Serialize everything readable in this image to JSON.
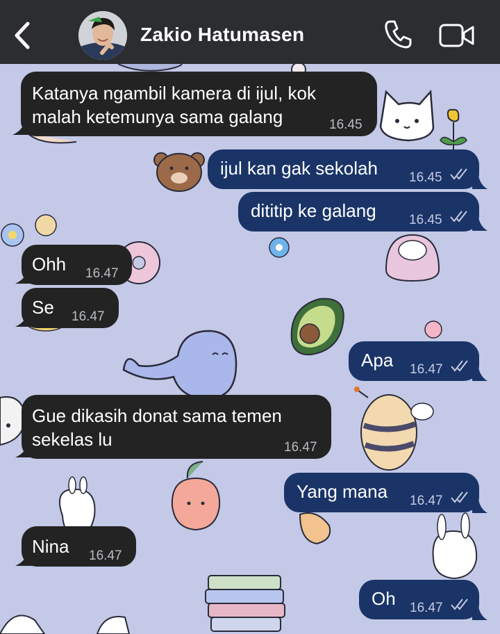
{
  "header": {
    "back_icon": "chevron-left-icon",
    "contact_name": "Zakio Hatumasen",
    "call_icon": "phone-icon",
    "video_icon": "video-camera-icon"
  },
  "colors": {
    "header_bg": "#2b2d30",
    "incoming_bubble": "#232323",
    "outgoing_bubble": "#1a3468",
    "wallpaper": "#c3c9e6"
  },
  "messages": [
    {
      "direction": "in",
      "lines": [
        "Katanya ngambil kamera di ijul, kok",
        "malah ketemunya sama galang"
      ],
      "time": "16.45"
    },
    {
      "direction": "out",
      "text": "ijul kan gak sekolah",
      "time": "16.45",
      "read": true
    },
    {
      "direction": "out",
      "text": "dititip ke galang",
      "time": "16.45",
      "read": true
    },
    {
      "direction": "in",
      "text": "Ohh",
      "time": "16.47"
    },
    {
      "direction": "in",
      "text": "Se",
      "time": "16.47"
    },
    {
      "direction": "out",
      "text": "Apa",
      "time": "16.47",
      "read": true
    },
    {
      "direction": "in",
      "lines": [
        "Gue dikasih donat sama temen",
        "sekelas lu"
      ],
      "time": "16.47"
    },
    {
      "direction": "out",
      "text": "Yang mana",
      "time": "16.47",
      "read": true
    },
    {
      "direction": "in",
      "text": "Nina",
      "time": "16.47"
    },
    {
      "direction": "out",
      "text": "Oh",
      "time": "16.47",
      "read": true
    }
  ],
  "wallpaper_doodles": [
    "whale",
    "bear",
    "cat",
    "avocado",
    "bee",
    "peach",
    "bunny",
    "flower",
    "books",
    "tulip",
    "donut"
  ]
}
